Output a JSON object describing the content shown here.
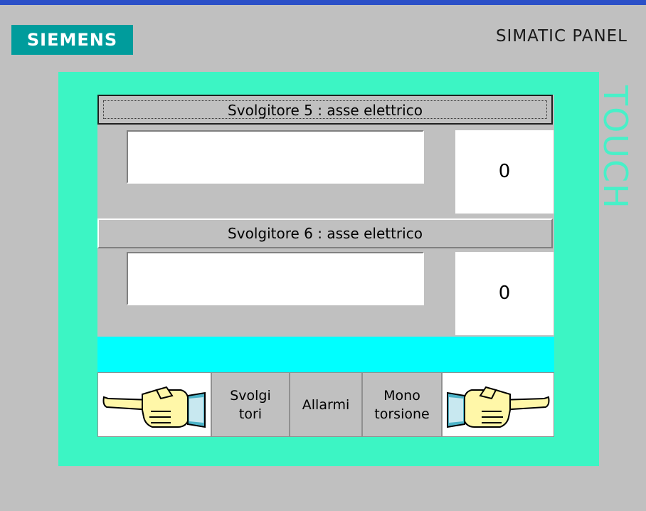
{
  "brand": {
    "logo_text": "SIEMENS",
    "panel_title": "SIMATIC PANEL",
    "vertical_label": "TOUCH"
  },
  "colors": {
    "top_bar": "#2b50c8",
    "logo_bg": "#009c9c",
    "frame": "#3cf5c4",
    "status_strip": "#00ffff",
    "touch_text": "#48f0c8",
    "background": "#c0c0c0"
  },
  "axes": [
    {
      "title": "Svolgitore 5 : asse elettrico",
      "text_value": "",
      "value": "0"
    },
    {
      "title": "Svolgitore 6 : asse elettrico",
      "text_value": "",
      "value": "0"
    }
  ],
  "status": {
    "message": ""
  },
  "softkeys": [
    {
      "icon": "hand-point-left-icon",
      "label": ""
    },
    {
      "label": "Svolgi\ntori"
    },
    {
      "label": "Allarmi"
    },
    {
      "label": "Mono\ntorsione"
    },
    {
      "icon": "hand-point-right-icon",
      "label": ""
    }
  ]
}
